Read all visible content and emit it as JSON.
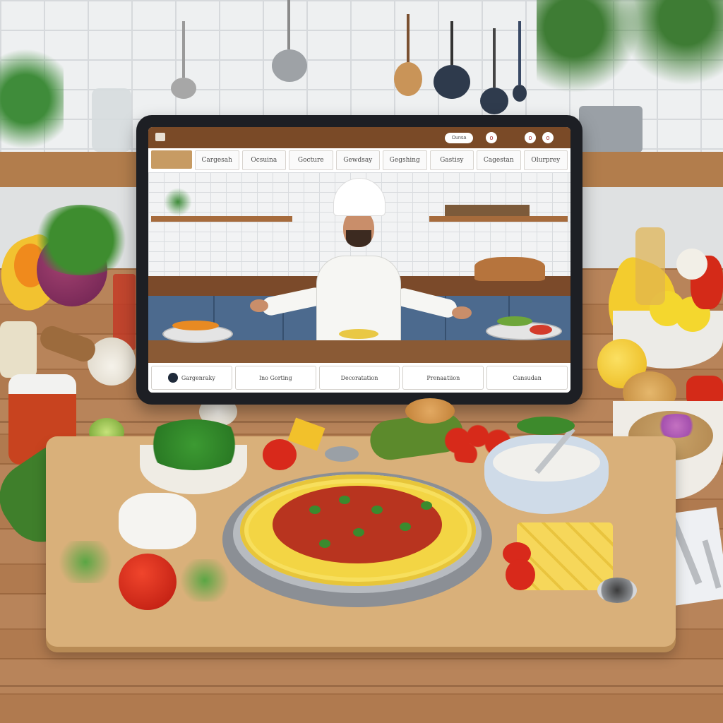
{
  "tablet": {
    "topbar": {
      "pill_label": "Ounsa",
      "buttons": [
        "o",
        "o",
        "o"
      ]
    },
    "nav_tabs": [
      "Cargesah",
      "Ocsuina",
      "Gocture",
      "Gewdsay",
      "Gegshing",
      "Gastisy",
      "Cagestan",
      "Olurprey"
    ],
    "bottom_cards": [
      "Gargenraky",
      "Ino Gorting",
      "Decoratation",
      "Prenaatiion",
      "Cansudan"
    ]
  },
  "colors": {
    "topbar": "#7a4a27",
    "cabinet": "#4c6a8e",
    "table_wood": "#b07a4f",
    "board": "#d9b07a",
    "pasta": "#f3d544",
    "sauce": "#b8341f"
  }
}
